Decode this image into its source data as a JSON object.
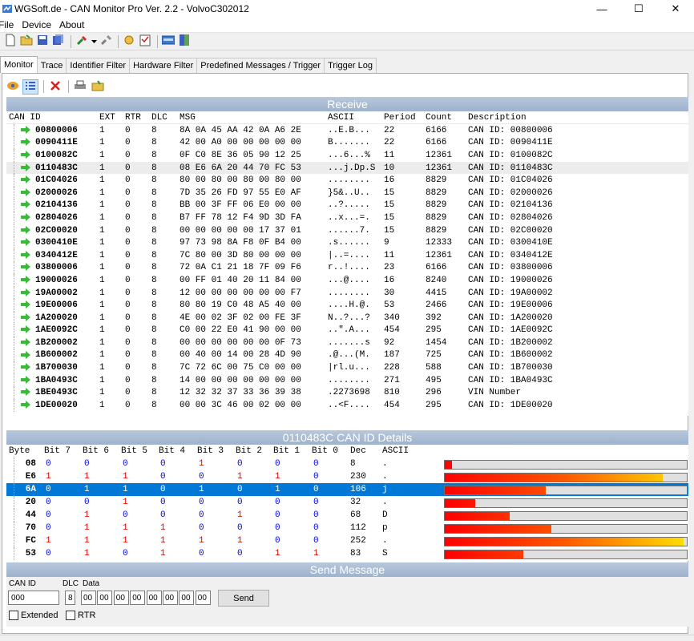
{
  "window": {
    "title": "WGSoft.de - CAN Monitor Pro Ver. 2.2 - VolvoC302012",
    "minimize": "—",
    "maximize": "☐",
    "close": "✕"
  },
  "menu": [
    "File",
    "Device",
    "About"
  ],
  "tabs": [
    "Monitor",
    "Trace",
    "Identifier Filter",
    "Hardware Filter",
    "Predefined Messages / Trigger",
    "Trigger Log"
  ],
  "receive": {
    "title": "Receive",
    "columns": [
      "CAN ID",
      "EXT",
      "RTR",
      "DLC",
      "MSG",
      "ASCII",
      "Period",
      "Count",
      "Description"
    ],
    "selected_index": 3,
    "rows": [
      [
        "00800006",
        "1",
        "0",
        "8",
        "8A 0A 45 AA 42 0A A6 2E",
        "..E.B...",
        "22",
        "6166",
        "CAN ID: 00800006"
      ],
      [
        "0090411E",
        "1",
        "0",
        "8",
        "42 00 A0 00 00 00 00 00",
        "B.......",
        "22",
        "6166",
        "CAN ID: 0090411E"
      ],
      [
        "0100082C",
        "1",
        "0",
        "8",
        "0F C0 8E 36 05 90 12 25",
        "...6...%",
        "11",
        "12361",
        "CAN ID: 0100082C"
      ],
      [
        "0110483C",
        "1",
        "0",
        "8",
        "08 E6 6A 20 44 70 FC 53",
        "...j.Dp.S",
        "10",
        "12361",
        "CAN ID: 0110483C"
      ],
      [
        "01C04026",
        "1",
        "0",
        "8",
        "80 00 80 00 80 00 80 00",
        "........",
        "16",
        "8829",
        "CAN ID: 01C04026"
      ],
      [
        "02000026",
        "1",
        "0",
        "8",
        "7D 35 26 FD 97 55 E0 AF",
        "}5&..U..",
        "15",
        "8829",
        "CAN ID: 02000026"
      ],
      [
        "02104136",
        "1",
        "0",
        "8",
        "BB 00 3F FF 06 E0 00 00",
        "..?.....",
        "15",
        "8829",
        "CAN ID: 02104136"
      ],
      [
        "02804026",
        "1",
        "0",
        "8",
        "B7 FF 78 12 F4 9D 3D FA",
        "..x...=.",
        "15",
        "8829",
        "CAN ID: 02804026"
      ],
      [
        "02C00020",
        "1",
        "0",
        "8",
        "00 00 00 00 00 17 37 01",
        "......7.",
        "15",
        "8829",
        "CAN ID: 02C00020"
      ],
      [
        "0300410E",
        "1",
        "0",
        "8",
        "97 73 98 8A F8 0F B4 00",
        ".s......",
        "9",
        "12333",
        "CAN ID: 0300410E"
      ],
      [
        "0340412E",
        "1",
        "0",
        "8",
        "7C 80 00 3D 80 00 00 00",
        "|..=....",
        "11",
        "12361",
        "CAN ID: 0340412E"
      ],
      [
        "03800006",
        "1",
        "0",
        "8",
        "72 0A C1 21 18 7F 09 F6",
        "r..!....",
        "23",
        "6166",
        "CAN ID: 03800006"
      ],
      [
        "19000026",
        "1",
        "0",
        "8",
        "00 FF 01 40 20 11 84 00",
        "...@....",
        "16",
        "8240",
        "CAN ID: 19000026"
      ],
      [
        "19A00002",
        "1",
        "0",
        "8",
        "12 00 00 00 00 00 00 F7",
        "........",
        "30",
        "4415",
        "CAN ID: 19A00002"
      ],
      [
        "19E00006",
        "1",
        "0",
        "8",
        "80 80 19 C0 48 A5 40 00",
        "....H.@.",
        "53",
        "2466",
        "CAN ID: 19E00006"
      ],
      [
        "1A200020",
        "1",
        "0",
        "8",
        "4E 00 02 3F 02 00 FE 3F",
        "N..?...?",
        "340",
        "392",
        "CAN ID: 1A200020"
      ],
      [
        "1AE0092C",
        "1",
        "0",
        "8",
        "C0 00 22 E0 41 90 00 00",
        "..\".A...",
        "454",
        "295",
        "CAN ID: 1AE0092C"
      ],
      [
        "1B200002",
        "1",
        "0",
        "8",
        "00 00 00 00 00 00 0F 73",
        ".......s",
        "92",
        "1454",
        "CAN ID: 1B200002"
      ],
      [
        "1B600002",
        "1",
        "0",
        "8",
        "00 40 00 14 00 28 4D 90",
        ".@...(M.",
        "187",
        "725",
        "CAN ID: 1B600002"
      ],
      [
        "1B700030",
        "1",
        "0",
        "8",
        "7C 72 6C 00 75 C0 00 00",
        "|rl.u...",
        "228",
        "588",
        "CAN ID: 1B700030"
      ],
      [
        "1BA0493C",
        "1",
        "0",
        "8",
        "14 00 00 00 00 00 00 00",
        "........",
        "271",
        "495",
        "CAN ID: 1BA0493C"
      ],
      [
        "1BE0493C",
        "1",
        "0",
        "8",
        "12 32 32 37 33 36 39 38",
        ".2273698",
        "810",
        "296",
        "VIN Number"
      ],
      [
        "1DE00020",
        "1",
        "0",
        "8",
        "00 00 3C 46 00 02 00 00",
        "..<F....",
        "454",
        "295",
        "CAN ID: 1DE00020"
      ]
    ]
  },
  "details": {
    "title": "0110483C CAN ID Details",
    "columns": [
      "Byte",
      "Bit 7",
      "Bit 6",
      "Bit 5",
      "Bit 4",
      "Bit 3",
      "Bit 2",
      "Bit 1",
      "Bit 0",
      "Dec",
      "ASCII"
    ],
    "selected_index": 2,
    "rows": [
      {
        "byte": "08",
        "dec": "8",
        "ascii": ".",
        "level": 8
      },
      {
        "byte": "E6",
        "dec": "230",
        "ascii": ".",
        "level": 230
      },
      {
        "byte": "6A",
        "dec": "106",
        "ascii": "j",
        "level": 106
      },
      {
        "byte": "20",
        "dec": "32",
        "ascii": ".",
        "level": 32
      },
      {
        "byte": "44",
        "dec": "68",
        "ascii": "D",
        "level": 68
      },
      {
        "byte": "70",
        "dec": "112",
        "ascii": "p",
        "level": 112
      },
      {
        "byte": "FC",
        "dec": "252",
        "ascii": ".",
        "level": 252
      },
      {
        "byte": "53",
        "dec": "83",
        "ascii": "S",
        "level": 83
      }
    ],
    "max_level": 255
  },
  "send": {
    "title": "Send Message",
    "can_id_label": "CAN ID",
    "can_id_value": "000",
    "dlc_label": "DLC",
    "dlc_value": "8",
    "data_label": "Data",
    "data_values": [
      "00",
      "00",
      "00",
      "00",
      "00",
      "00",
      "00",
      "00"
    ],
    "send_button": "Send",
    "extended_label": "Extended",
    "rtr_label": "RTR"
  },
  "colors": {
    "header_blue": "#9db2cc",
    "selection_blue": "#0078d7",
    "bit_one": "#e00000",
    "bit_zero": "#0000e0"
  }
}
